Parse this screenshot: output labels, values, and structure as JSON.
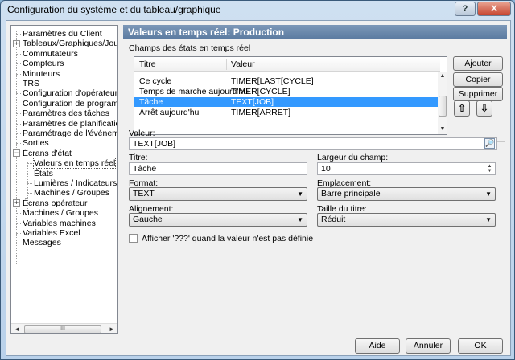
{
  "window": {
    "title": "Configuration du système et du tableau/graphique",
    "help_glyph": "?",
    "close_glyph": "X"
  },
  "tree": {
    "items": [
      {
        "label": "Paramètres du Client",
        "level": 0,
        "expander": ""
      },
      {
        "label": "Tableaux/Graphiques/Journa",
        "level": 0,
        "expander": "+"
      },
      {
        "label": "Commutateurs",
        "level": 0,
        "expander": ""
      },
      {
        "label": "Compteurs",
        "level": 0,
        "expander": ""
      },
      {
        "label": "Minuteurs",
        "level": 0,
        "expander": ""
      },
      {
        "label": "TRS",
        "level": 0,
        "expander": ""
      },
      {
        "label": "Configuration d'opérateur",
        "level": 0,
        "expander": ""
      },
      {
        "label": "Configuration de programme",
        "level": 0,
        "expander": ""
      },
      {
        "label": "Paramètres des tâches",
        "level": 0,
        "expander": ""
      },
      {
        "label": "Paramètres de planification",
        "level": 0,
        "expander": ""
      },
      {
        "label": "Paramétrage de l'événement",
        "level": 0,
        "expander": ""
      },
      {
        "label": "Sorties",
        "level": 0,
        "expander": ""
      },
      {
        "label": "Écrans d'état",
        "level": 0,
        "expander": "−"
      },
      {
        "label": "Valeurs en temps réel",
        "level": 1,
        "expander": "",
        "selected": true
      },
      {
        "label": "États",
        "level": 1,
        "expander": ""
      },
      {
        "label": "Lumières / Indicateurs",
        "level": 1,
        "expander": ""
      },
      {
        "label": "Machines / Groupes",
        "level": 1,
        "expander": ""
      },
      {
        "label": "Écrans opérateur",
        "level": 0,
        "expander": "+"
      },
      {
        "label": "Machines / Groupes",
        "level": 0,
        "expander": ""
      },
      {
        "label": "Variables machines",
        "level": 0,
        "expander": ""
      },
      {
        "label": "Variables Excel",
        "level": 0,
        "expander": ""
      },
      {
        "label": "Messages",
        "level": 0,
        "expander": ""
      }
    ],
    "scroll_left": "◄",
    "scroll_right": "►",
    "scroll_grip": "III"
  },
  "panel": {
    "title": "Valeurs en temps réel: Production",
    "group_label": "Champs des états en temps réel",
    "list": {
      "columns": [
        "Titre",
        "Valeur"
      ],
      "rows": [
        [
          "Ce cycle",
          "TIMER[LAST[CYCLE]"
        ],
        [
          "Temps de marche aujourd'hui",
          "TIMER[CYCLE]"
        ],
        [
          "Tâche",
          "TEXT[JOB]"
        ],
        [
          "Arrêt aujourd'hui",
          "TIMER[ARRET]"
        ]
      ],
      "selected_row": 2,
      "scroll_up": "▲",
      "scroll_down": "▼"
    },
    "buttons": {
      "add": "Ajouter",
      "copy": "Copier",
      "delete": "Supprimer",
      "move_up": "⇧",
      "move_down": "⇩"
    },
    "value": {
      "label": "Valeur:",
      "text": "TEXT[JOB]",
      "find_glyph": "🔎"
    },
    "title_field": {
      "label": "Titre:",
      "text": "Tâche"
    },
    "width": {
      "label": "Largeur du champ:",
      "text": "10",
      "spin_up": "▲",
      "spin_down": "▼"
    },
    "format": {
      "label": "Format:",
      "selected": "TEXT"
    },
    "placement": {
      "label": "Emplacement:",
      "selected": "Barre principale"
    },
    "alignment": {
      "label": "Alignement:",
      "selected": "Gauche"
    },
    "title_size": {
      "label": "Taille du titre:",
      "selected": "Réduit"
    },
    "checkbox": {
      "label": "Afficher '???' quand la valeur n'est pas définie",
      "checked": false
    },
    "dropdown_glyph": "▼"
  },
  "dialog_buttons": {
    "help": "Aide",
    "cancel": "Annuler",
    "ok": "OK"
  }
}
